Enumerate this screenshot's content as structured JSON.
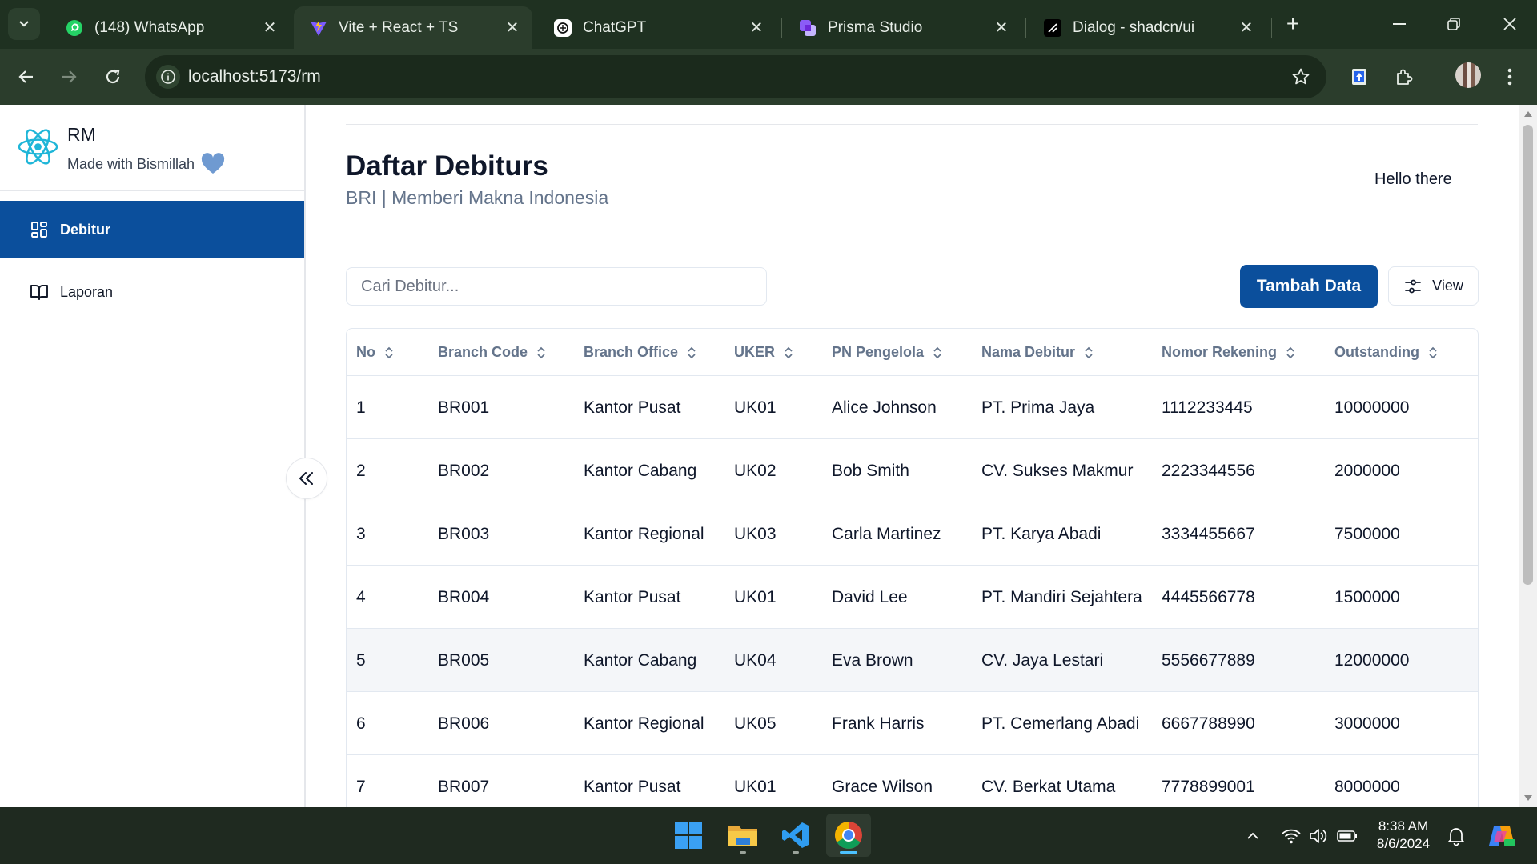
{
  "browser": {
    "tabs": [
      {
        "title": "(148) WhatsApp",
        "icon": "whatsapp-icon",
        "active": false
      },
      {
        "title": "Vite + React + TS",
        "icon": "vite-icon",
        "active": true
      },
      {
        "title": "ChatGPT",
        "icon": "chatgpt-icon",
        "active": false
      },
      {
        "title": "Prisma Studio",
        "icon": "prisma-icon",
        "active": false
      },
      {
        "title": "Dialog - shadcn/ui",
        "icon": "shadcn-icon",
        "active": false
      }
    ],
    "url": "localhost:5173/rm"
  },
  "sidebar": {
    "app_name": "RM",
    "tagline": "Made with Bismillah",
    "items": [
      {
        "label": "Debitur",
        "icon": "dashboard-grid-icon",
        "active": true
      },
      {
        "label": "Laporan",
        "icon": "book-open-icon",
        "active": false
      }
    ]
  },
  "header": {
    "title": "Daftar Debiturs",
    "subtitle": "BRI | Memberi Makna Indonesia",
    "greeting": "Hello there"
  },
  "toolbar": {
    "search_placeholder": "Cari Debitur...",
    "add_label": "Tambah Data",
    "view_label": "View"
  },
  "table": {
    "columns": [
      "No",
      "Branch Code",
      "Branch Office",
      "UKER",
      "PN Pengelola",
      "Nama Debitur",
      "Nomor Rekening",
      "Outstanding"
    ],
    "rows": [
      [
        "1",
        "BR001",
        "Kantor Pusat",
        "UK01",
        "Alice Johnson",
        "PT. Prima Jaya",
        "1112233445",
        "10000000"
      ],
      [
        "2",
        "BR002",
        "Kantor Cabang",
        "UK02",
        "Bob Smith",
        "CV. Sukses Makmur",
        "2223344556",
        "2000000"
      ],
      [
        "3",
        "BR003",
        "Kantor Regional",
        "UK03",
        "Carla Martinez",
        "PT. Karya Abadi",
        "3334455667",
        "7500000"
      ],
      [
        "4",
        "BR004",
        "Kantor Pusat",
        "UK01",
        "David Lee",
        "PT. Mandiri Sejahtera",
        "4445566778",
        "1500000"
      ],
      [
        "5",
        "BR005",
        "Kantor Cabang",
        "UK04",
        "Eva Brown",
        "CV. Jaya Lestari",
        "5556677889",
        "12000000"
      ],
      [
        "6",
        "BR006",
        "Kantor Regional",
        "UK05",
        "Frank Harris",
        "PT. Cemerlang Abadi",
        "6667788990",
        "3000000"
      ],
      [
        "7",
        "BR007",
        "Kantor Pusat",
        "UK01",
        "Grace Wilson",
        "CV. Berkat Utama",
        "7778899001",
        "8000000"
      ]
    ]
  },
  "taskbar": {
    "time": "8:38 AM",
    "date": "8/6/2024"
  },
  "colors": {
    "primary": "#0b4f9c",
    "browser_dark": "#1f3121",
    "muted_text": "#64748b"
  }
}
